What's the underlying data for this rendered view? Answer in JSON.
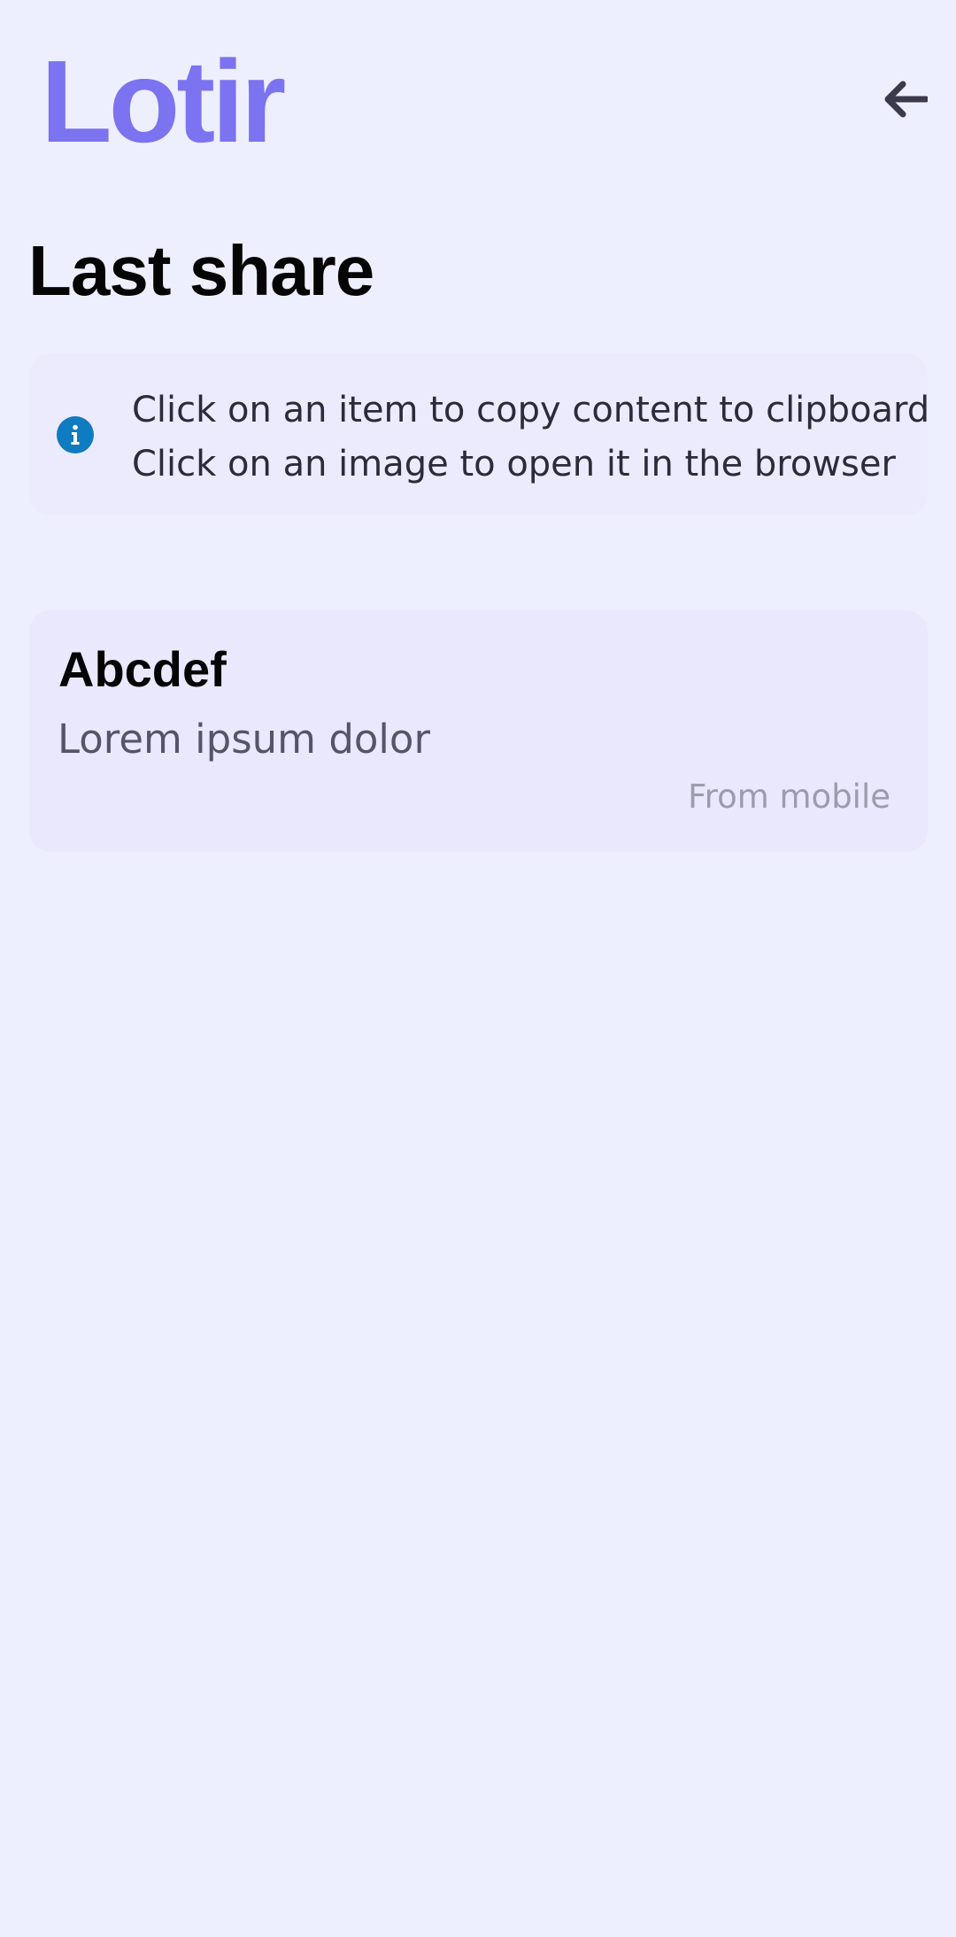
{
  "header": {
    "logo_text": "Lotir",
    "back_icon": "arrow-left-icon"
  },
  "page": {
    "title": "Last share"
  },
  "info": {
    "icon": "info-icon",
    "line1": "Click on an item to copy content to clipboard",
    "line2": "Click on an image to open it in the browser"
  },
  "shares": [
    {
      "title": "Abcdef",
      "content": "Lorem ipsum dolor",
      "source": "From mobile"
    }
  ],
  "colors": {
    "background": "#EEEFFE",
    "brand": "#7B73F0",
    "info_icon": "#0F7BC0",
    "card_background": "#EAE8FD"
  }
}
